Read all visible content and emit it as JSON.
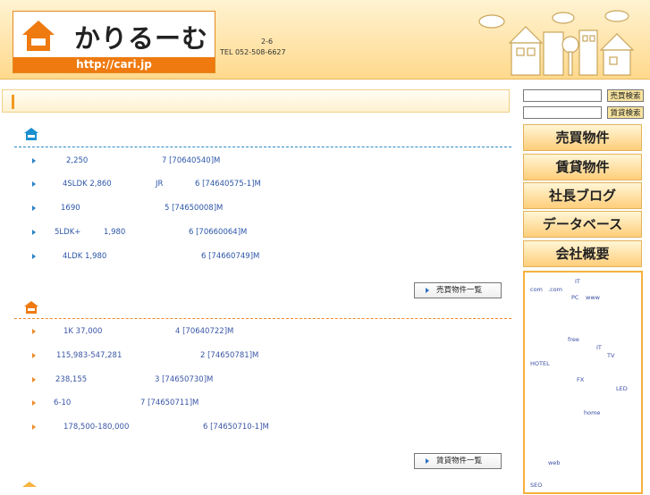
{
  "header": {
    "logo_text": "かりるーむ",
    "logo_url": "http://cari.jp",
    "address": "2-6",
    "tel": "TEL 052-508-6627"
  },
  "sections": [
    {
      "rows": [
        {
          "price": "2,250",
          "tail": "7  [70640540]M"
        },
        {
          "price": "4SLDK 2,860",
          "mid": "JR",
          "tail": "6  [74640575-1]M"
        },
        {
          "price": "1690",
          "tail": "5  [74650008]M"
        },
        {
          "price": "5LDK+",
          "mid": "1,980",
          "tail": "6  [70660064]M"
        },
        {
          "price": "4LDK 1,980",
          "tail": "6  [74660749]M"
        }
      ],
      "list_button": "売買物件一覧"
    },
    {
      "rows": [
        {
          "price": "1K 37,000",
          "tail": "4  [70640722]M"
        },
        {
          "price": "115,983-547,281",
          "tail": "2  [74650781]M"
        },
        {
          "price": "238,155",
          "tail": "3  [74650730]M"
        },
        {
          "price": "6-10",
          "tail": "7  [74650711]M"
        },
        {
          "price": "178,500-180,000",
          "tail": "6  [74650710-1]M"
        }
      ],
      "list_button": "賃貸物件一覧"
    }
  ],
  "sidebar": {
    "search_sale_button": "売買検索",
    "search_rent_button": "賃貸検索",
    "nav": [
      "売買物件",
      "賃貸物件",
      "社長ブログ",
      "データベース",
      "会社概要"
    ],
    "links": [
      "IT",
      "com",
      ".com",
      "PC",
      "www",
      "free",
      "IT",
      "TV",
      "HOTEL",
      "FX",
      "LED",
      "home",
      "web",
      "SEO"
    ]
  },
  "colors": {
    "accent_orange": "#ee7a10",
    "sale_blue": "#1b8fd0",
    "rent_orange": "#ee7a10",
    "link_blue": "#3b4ea4"
  }
}
